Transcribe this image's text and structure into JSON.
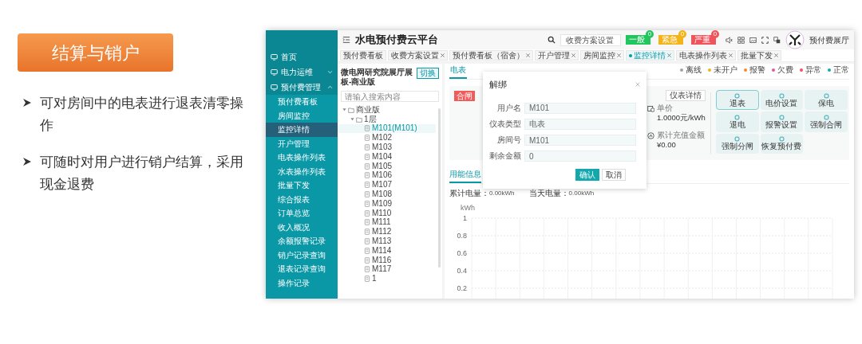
{
  "slide": {
    "title": "结算与销户",
    "bullets": [
      "可对房间中的电表进行退表清零操作",
      "可随时对用户进行销户结算，采用现金退费"
    ]
  },
  "app": {
    "sidebar": {
      "items": [
        {
          "label": "首页",
          "kind": "link",
          "selected": false
        },
        {
          "label": "电力运维",
          "kind": "group",
          "expanded": false,
          "selected": false
        },
        {
          "label": "预付费管理",
          "kind": "group",
          "expanded": true,
          "selected": false,
          "children": [
            {
              "label": "预付费看板",
              "selected": false
            },
            {
              "label": "房间监控",
              "selected": false
            },
            {
              "label": "监控详情",
              "selected": true
            },
            {
              "label": "开户管理",
              "selected": false
            },
            {
              "label": "电表操作列表",
              "selected": false
            },
            {
              "label": "水表操作列表",
              "selected": false
            },
            {
              "label": "批量下发",
              "selected": false
            },
            {
              "label": "综合报表",
              "selected": false
            },
            {
              "label": "订单总览",
              "selected": false
            },
            {
              "label": "收入概况",
              "selected": false
            },
            {
              "label": "余额报警记录",
              "selected": false
            },
            {
              "label": "销户记录查询",
              "selected": false
            },
            {
              "label": "退表记录查询",
              "selected": false
            },
            {
              "label": "操作记录",
              "selected": false
            }
          ]
        }
      ]
    },
    "header": {
      "title": "水电预付费云平台",
      "search": {
        "value": "收费方案设置"
      },
      "alerts": [
        {
          "label": "一般",
          "count": "0",
          "color": "#22c55e"
        },
        {
          "label": "紧急",
          "count": "0",
          "color": "#f5b31a"
        },
        {
          "label": "严重",
          "count": "0",
          "color": "#f0545c"
        }
      ],
      "user": "预付费展厅"
    },
    "tabs": [
      {
        "label": "预付费看板",
        "closable": false,
        "selected": false
      },
      {
        "label": "收费方案设置",
        "closable": true,
        "selected": false
      },
      {
        "label": "预付费看板（宿舍）",
        "closable": true,
        "selected": false
      },
      {
        "label": "开户管理",
        "closable": true,
        "selected": false
      },
      {
        "label": "房间监控",
        "closable": true,
        "selected": false
      },
      {
        "label": "监控详情",
        "closable": true,
        "selected": true
      },
      {
        "label": "电表操作列表",
        "closable": true,
        "selected": false
      },
      {
        "label": "批量下发",
        "closable": true,
        "selected": false
      }
    ],
    "tree_panel": {
      "title": "微电网研究院展厅展板-商业版",
      "switch_button": "切换",
      "search": {
        "placeholder": "请输入搜索内容"
      },
      "tree": [
        {
          "label": "商业版",
          "expanded": true,
          "children": [
            {
              "label": "1层",
              "expanded": true,
              "children": [
                {
                  "label": "M101(M101)",
                  "selected": true
                },
                {
                  "label": "M102",
                  "selected": false
                },
                {
                  "label": "M103",
                  "selected": false
                },
                {
                  "label": "M104",
                  "selected": false
                },
                {
                  "label": "M105",
                  "selected": false
                },
                {
                  "label": "M106",
                  "selected": false
                },
                {
                  "label": "M107",
                  "selected": false
                },
                {
                  "label": "M108",
                  "selected": false
                },
                {
                  "label": "M109",
                  "selected": false
                },
                {
                  "label": "M110",
                  "selected": false
                },
                {
                  "label": "M111",
                  "selected": false
                },
                {
                  "label": "M112",
                  "selected": false
                },
                {
                  "label": "M113",
                  "selected": false
                },
                {
                  "label": "M114",
                  "selected": false
                },
                {
                  "label": "M116",
                  "selected": false
                },
                {
                  "label": "M117",
                  "selected": false
                },
                {
                  "label": "1",
                  "selected": false
                }
              ]
            }
          ]
        }
      ]
    },
    "detail": {
      "meter_tabs": [
        {
          "label": "电表",
          "selected": true
        }
      ],
      "legend": [
        {
          "label": "离线",
          "color": "#a3a3a3"
        },
        {
          "label": "未开户",
          "color": "#f5b31a"
        },
        {
          "label": "报警",
          "color": "#f28b30"
        },
        {
          "label": "欠费",
          "color": "#e0589a"
        },
        {
          "label": "异常",
          "color": "#f0545c"
        },
        {
          "label": "正常",
          "color": "#14a8b0"
        }
      ],
      "status_tag": "合闸",
      "meter_detail_button": "仪表详情",
      "info": [
        {
          "label": "单价",
          "value": "1.0000元/kWh"
        },
        {
          "label": "累计充值金额",
          "value": "¥0.00"
        }
      ],
      "actions": [
        {
          "label": "退表",
          "selected": true
        },
        {
          "label": "电价设置",
          "selected": false
        },
        {
          "label": "保电",
          "selected": false
        },
        {
          "label": "退电",
          "selected": false
        },
        {
          "label": "报警设置",
          "selected": false
        },
        {
          "label": "强制合闸",
          "selected": false
        },
        {
          "label": "强制分闸",
          "selected": false
        },
        {
          "label": "恢复预付费",
          "selected": false
        }
      ],
      "usage_tabs": [
        {
          "label": "用能信息",
          "selected": true
        }
      ],
      "stats": [
        {
          "label": "累计电量：",
          "value": "0.00kWh"
        },
        {
          "label": "当天电量：",
          "value": "0.00kWh"
        }
      ],
      "usage_chart": {
        "unit": "kWh",
        "y_labels": [
          "1",
          "0.8",
          "0.6",
          "0.4",
          "0.2"
        ]
      }
    },
    "dialog": {
      "title": "解绑",
      "fields": [
        {
          "label": "用户名",
          "value": "M101"
        },
        {
          "label": "仪表类型",
          "value": "电表"
        },
        {
          "label": "房间号",
          "value": "M101"
        },
        {
          "label": "剩余金额",
          "value": "0"
        }
      ],
      "buttons": [
        {
          "label": "确认",
          "kind": "primary"
        },
        {
          "label": "取消",
          "kind": "default"
        }
      ]
    }
  }
}
